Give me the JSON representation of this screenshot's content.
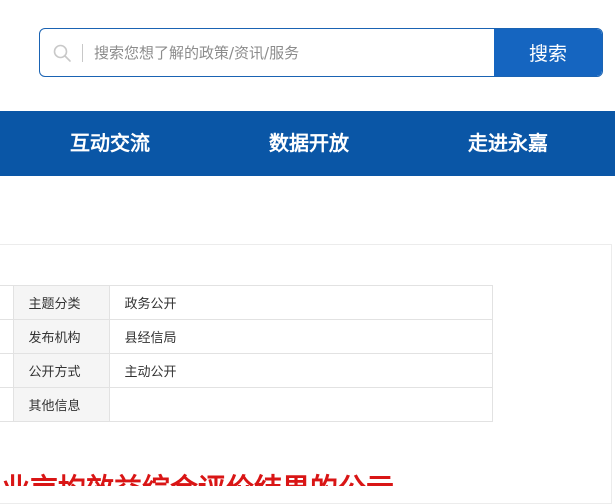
{
  "search": {
    "placeholder": "搜索您想了解的政策/资讯/服务",
    "button_label": "搜索"
  },
  "nav": {
    "items": [
      {
        "label": "互动交流"
      },
      {
        "label": "数据开放"
      },
      {
        "label": "走进永嘉"
      }
    ]
  },
  "meta_table": {
    "rows": [
      {
        "label": "主题分类",
        "value": "政务公开"
      },
      {
        "label": "发布机构",
        "value": "县经信局"
      },
      {
        "label": "公开方式",
        "value": "主动公开"
      },
      {
        "label": "其他信息",
        "value": ""
      }
    ]
  },
  "document": {
    "title_partial": "业亩均效益综合评价结果的公示"
  },
  "colors": {
    "brand_blue": "#0a56a6",
    "button_blue": "#1565c0",
    "title_red": "#d91515"
  }
}
